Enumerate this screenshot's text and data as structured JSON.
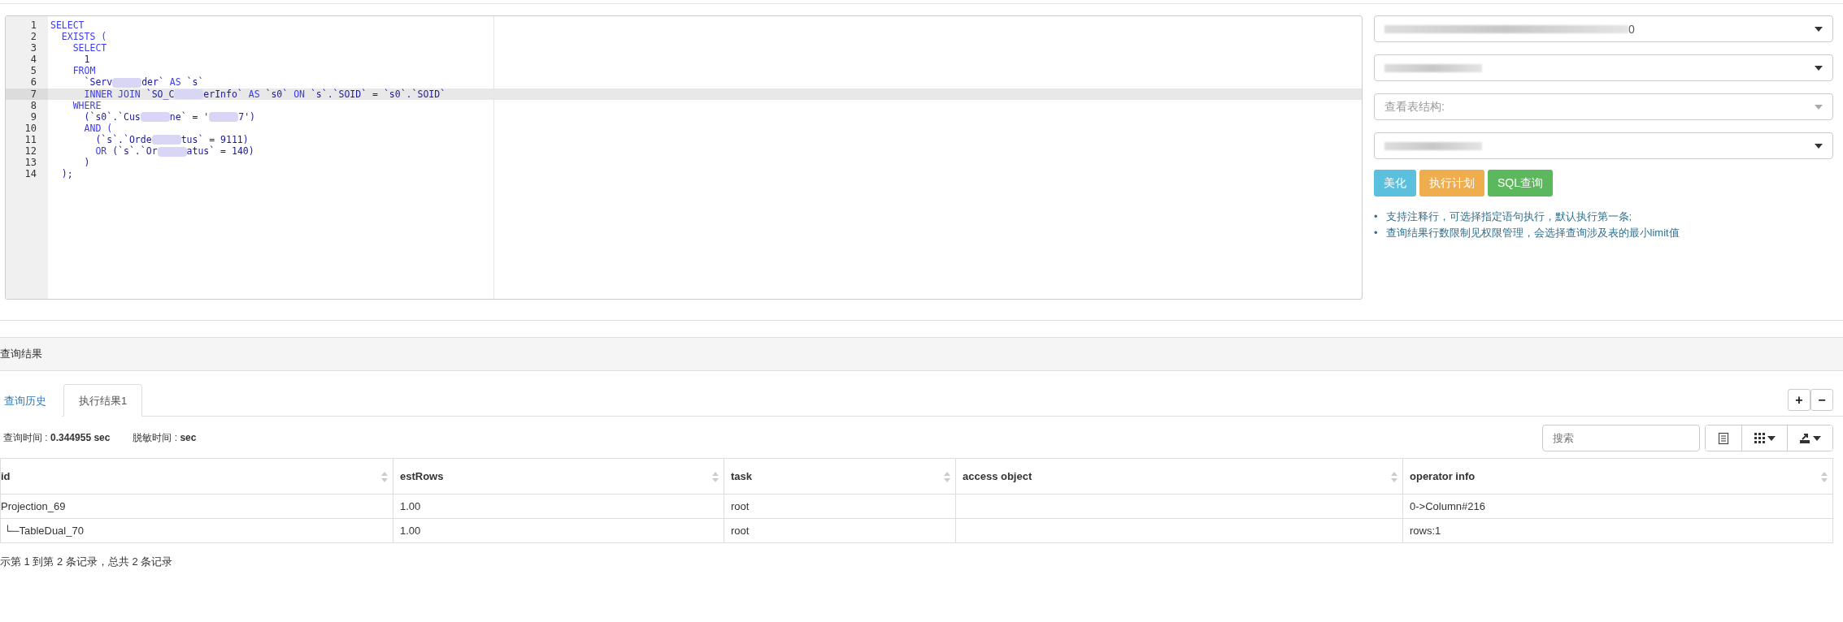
{
  "editor": {
    "lines": [
      {
        "number": "1",
        "current": false,
        "tokens": [
          {
            "kind": "keyword",
            "text": "SELECT"
          }
        ]
      },
      {
        "number": "2",
        "current": false,
        "tokens": [
          {
            "kind": "keyword",
            "text": "  EXISTS ("
          }
        ]
      },
      {
        "number": "3",
        "current": false,
        "tokens": [
          {
            "kind": "keyword",
            "text": "    SELECT"
          }
        ]
      },
      {
        "number": "4",
        "current": false,
        "tokens": [
          {
            "kind": "number",
            "text": "      1"
          }
        ]
      },
      {
        "number": "5",
        "current": false,
        "tokens": [
          {
            "kind": "keyword",
            "text": "    FROM"
          }
        ]
      },
      {
        "number": "6",
        "current": false,
        "tokens": [
          {
            "kind": "identifier",
            "text": "      `Serv",
            "blur_after": true
          },
          {
            "kind": "identifier",
            "text": "der` "
          },
          {
            "kind": "keyword",
            "text": "AS "
          },
          {
            "kind": "identifier",
            "text": "`s`"
          }
        ]
      },
      {
        "number": "7",
        "current": true,
        "tokens": [
          {
            "kind": "keyword",
            "text": "      INNER JOIN "
          },
          {
            "kind": "identifier",
            "text": "`SO_C",
            "blur_after": true
          },
          {
            "kind": "identifier",
            "text": "erInfo` "
          },
          {
            "kind": "keyword",
            "text": "AS "
          },
          {
            "kind": "identifier",
            "text": "`s0` "
          },
          {
            "kind": "keyword",
            "text": "ON "
          },
          {
            "kind": "identifier",
            "text": "`s`.`SOID` = `s0`.`SOID`"
          }
        ]
      },
      {
        "number": "8",
        "current": false,
        "tokens": [
          {
            "kind": "keyword",
            "text": "    WHERE"
          }
        ]
      },
      {
        "number": "9",
        "current": false,
        "tokens": [
          {
            "kind": "identifier",
            "text": "      (`s0`.`Cus",
            "blur_after": true
          },
          {
            "kind": "identifier",
            "text": "ne` = '",
            "blur_after": true
          },
          {
            "kind": "identifier",
            "text": "7')"
          }
        ]
      },
      {
        "number": "10",
        "current": false,
        "tokens": [
          {
            "kind": "keyword",
            "text": "      AND ("
          }
        ]
      },
      {
        "number": "11",
        "current": false,
        "tokens": [
          {
            "kind": "identifier",
            "text": "        (`s`.`Orde",
            "blur_after": true
          },
          {
            "kind": "identifier",
            "text": "tus` = "
          },
          {
            "kind": "number",
            "text": "9111"
          },
          {
            "kind": "identifier",
            "text": ")"
          }
        ]
      },
      {
        "number": "12",
        "current": false,
        "tokens": [
          {
            "kind": "keyword",
            "text": "        OR "
          },
          {
            "kind": "identifier",
            "text": "(`s`.`Or",
            "blur_after": true
          },
          {
            "kind": "identifier",
            "text": "atus` = "
          },
          {
            "kind": "number",
            "text": "140"
          },
          {
            "kind": "identifier",
            "text": ")"
          }
        ]
      },
      {
        "number": "13",
        "current": false,
        "tokens": [
          {
            "kind": "identifier",
            "text": "      )"
          }
        ]
      },
      {
        "number": "14",
        "current": false,
        "tokens": [
          {
            "kind": "identifier",
            "text": "  );"
          }
        ]
      }
    ]
  },
  "selects": [
    {
      "value": "0",
      "blurred": true
    },
    {
      "blurred": true
    },
    {
      "placeholder": "查看表结构:",
      "blurred": false
    },
    {
      "blurred": true
    }
  ],
  "buttons": [
    {
      "label": "美化",
      "color": "#5bc0de"
    },
    {
      "label": "执行计划",
      "color": "#f0ad4e"
    },
    {
      "label": "SQL查询",
      "color": "#5cb85c"
    }
  ],
  "notes": [
    {
      "bullet": "•",
      "text": "支持注释行，可选择指定语句执行，默认执行第一条;"
    },
    {
      "bullet": "•",
      "text": "查询结果行数限制见权限管理，会选择查询涉及表的最小limit值"
    }
  ],
  "results": {
    "title": "查询结果",
    "tabs": [
      {
        "label": "查询历史",
        "selected": false
      },
      {
        "label": "执行结果1",
        "selected": true
      }
    ],
    "tab_actions": [
      "+",
      "−"
    ],
    "stats": [
      {
        "label": "查询时间 : ",
        "value": "0.344955 sec"
      },
      {
        "label": "脱敏时间 : ",
        "value": "sec"
      }
    ],
    "search": {
      "placeholder": "搜索"
    },
    "table": {
      "columns": [
        "id",
        "estRows",
        "task",
        "access object",
        "operator info"
      ],
      "rows": [
        {
          "cells": [
            "Projection_69",
            "1.00",
            "root",
            "",
            "0->Column#216"
          ],
          "children": [
            {
              "cells": [
                "└─TableDual_70",
                "1.00",
                "root",
                "",
                "rows:1"
              ]
            }
          ]
        }
      ]
    },
    "footer": "示第 1 到第 2 条记录，总共 2 条记录"
  }
}
